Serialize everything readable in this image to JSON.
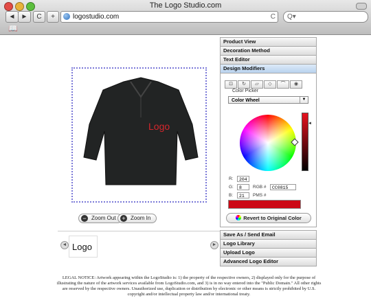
{
  "window": {
    "title": "The Logo Studio.com"
  },
  "toolbar": {
    "back": "◄",
    "forward": "►",
    "reload": "C",
    "add": "+",
    "url": "logostudio.com",
    "reload_glyph": "C",
    "search_placeholder": "Q▾",
    "bookmarks_icon": "📖"
  },
  "design": {
    "shirt_logo_text": "Logo",
    "zoom_out": "Zoom Out",
    "zoom_in": "Zoom In"
  },
  "panel": {
    "sections_top": [
      "Product View",
      "Decoration Method",
      "Text Editor",
      "Design Modifiers"
    ],
    "color_picker_label": "Color Picker",
    "picker_mode": "Color Wheel",
    "r_label": "R:",
    "g_label": "G:",
    "b_label": "B:",
    "r": "204",
    "g": "8",
    "b": "21",
    "rgb_label": "RGB #",
    "rgb_hex": "CC0815",
    "pms_label": "PMS #",
    "swatch_color": "#CC0815",
    "revert": "Revert to Original Color",
    "sections_bottom": [
      "Save As / Send Email",
      "Logo Library",
      "Upload Logo",
      "Advanced Logo Editor"
    ]
  },
  "tray": {
    "thumb_text": "Logo"
  },
  "legal": "LEGAL NOTICE: Artwork appearing within the LogoStudio is: 1) the property of the respective owners, 2) displayed only for the purpose of illustrating the nature of the artwork services available from LogoStudio.com, and 3) is in no way entered into the \"Public Domain.\" All other rights are reserved by the respective owners. Unauthorized use, duplication or distribution by electronic or other means is strictly prohibited by U.S. copyright and/or intellectual property law and/or international treaty."
}
